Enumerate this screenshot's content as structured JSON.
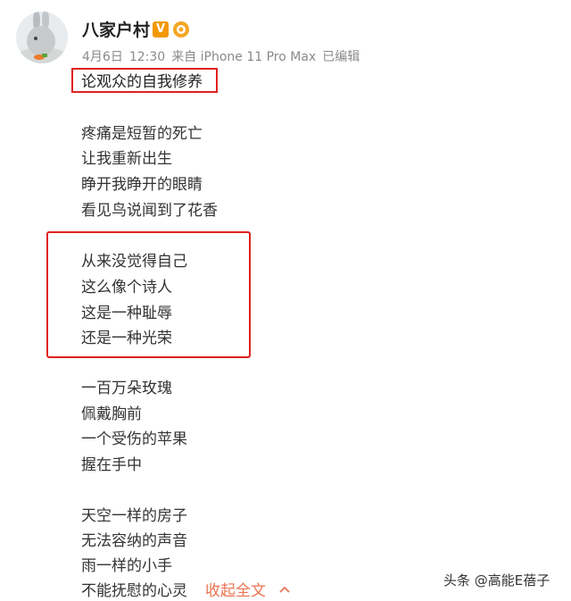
{
  "post": {
    "author": "八家户村",
    "verified_badge": "V",
    "level_icon": "level-badge-icon",
    "meta": {
      "date": "4月6日",
      "time": "12:30",
      "source": "来自 iPhone 11 Pro Max",
      "edited": "已编辑"
    },
    "title": "论观众的自我修养",
    "stanzas": [
      [
        "疼痛是短暂的死亡",
        "让我重新出生",
        "睁开我睁开的眼睛",
        "看见鸟说闻到了花香"
      ],
      [
        "从来没觉得自己",
        "这么像个诗人",
        "这是一种耻辱",
        "还是一种光荣"
      ],
      [
        "一百万朵玫瑰",
        "佩戴胸前",
        "一个受伤的苹果",
        "握在手中"
      ],
      [
        "天空一样的房子",
        "无法容纳的声音",
        "雨一样的小手",
        "不能抚慰的心灵"
      ]
    ],
    "collapse_label": "收起全文"
  },
  "watermark": "头条 @高能E蓓子",
  "colors": {
    "highlight_box": "#e02020",
    "link": "#eb7350",
    "verified": "#f39800"
  }
}
